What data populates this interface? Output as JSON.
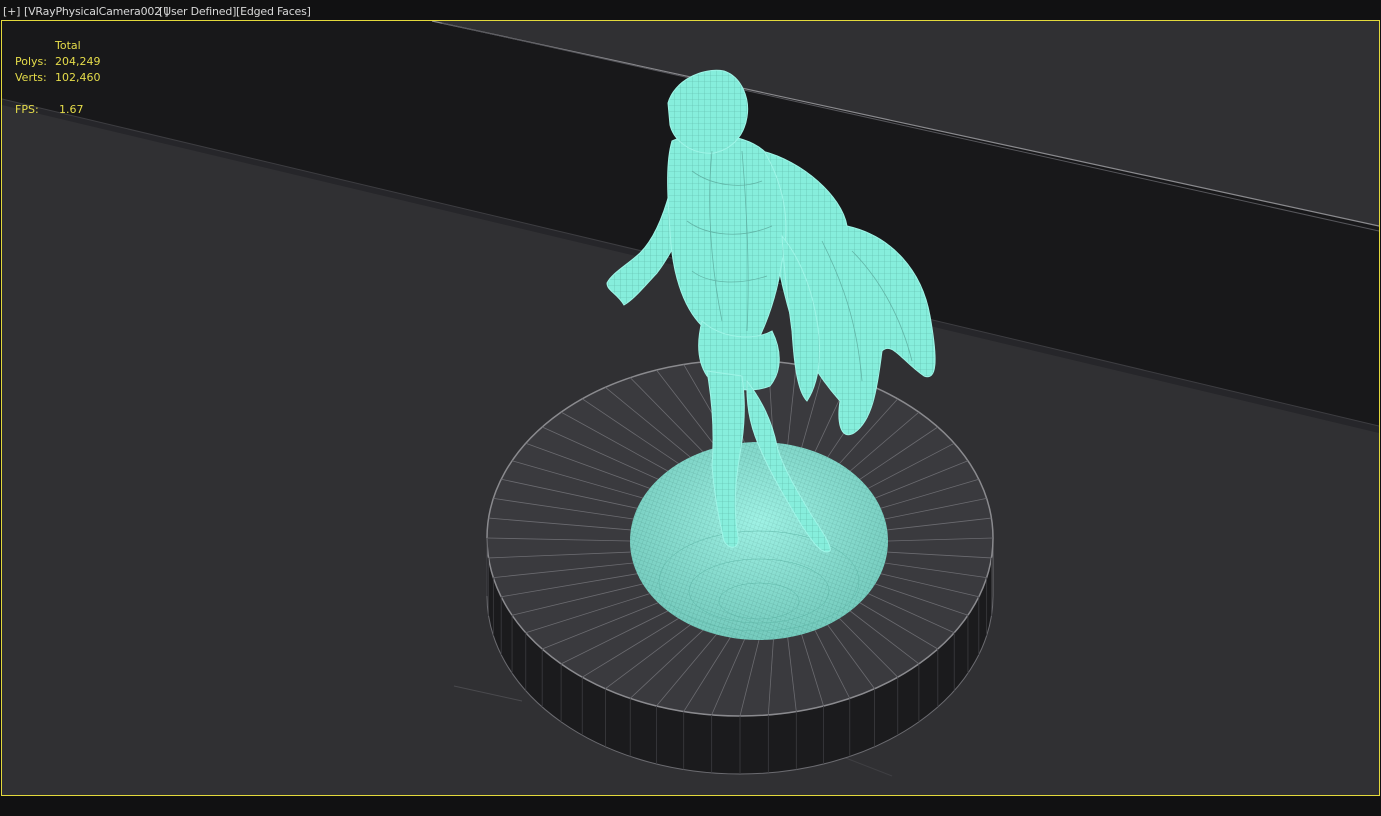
{
  "viewport_label": {
    "plus": "[+]",
    "camera": "[VRayPhysicalCamera002 ]",
    "shading_mode": "[User Defined]",
    "display": "[Edged Faces]"
  },
  "stats": {
    "header": "Total",
    "polys_label": "Polys:",
    "polys_value": "204,249",
    "verts_label": "Verts:",
    "verts_value": "102,460",
    "fps_label": "FPS:",
    "fps_value": "1.67"
  },
  "colors": {
    "viewport_border": "#e3d93c",
    "stats_text": "#e5dc4a",
    "floor": "#303033",
    "wall": "#161618",
    "wireframe": "#7ee8d6",
    "pedestal_side": "#1b1b1d",
    "pedestal_edges": "#8a8a8e"
  },
  "scene": {
    "object": "statue-wireframe",
    "pedestal": "cylinder-base",
    "background": "backdrop-wall"
  }
}
